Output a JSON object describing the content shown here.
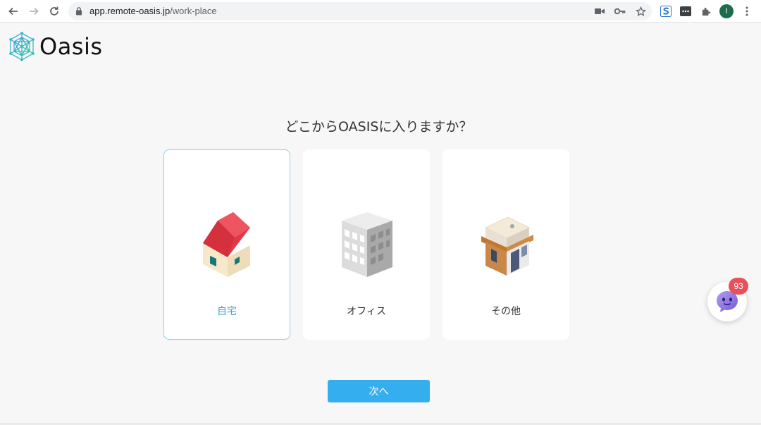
{
  "browser": {
    "url_host": "app.remote-oasis.jp",
    "url_path": "/work-place",
    "profile_initial": "I"
  },
  "app": {
    "logo_text": "Oasis"
  },
  "main": {
    "question": "どこからOASISに入りますか？",
    "options": [
      {
        "label": "自宅",
        "icon": "house-icon",
        "selected": true
      },
      {
        "label": "オフィス",
        "icon": "office-building-icon",
        "selected": false
      },
      {
        "label": "その他",
        "icon": "shop-icon",
        "selected": false
      }
    ],
    "next_label": "次へ"
  },
  "chat": {
    "badge_count": "93",
    "icon": "chat-bot-icon"
  },
  "colors": {
    "accent": "#35aef0",
    "selected_border": "#8fcde8",
    "selected_text": "#35a4d8",
    "badge": "#e8505b"
  }
}
